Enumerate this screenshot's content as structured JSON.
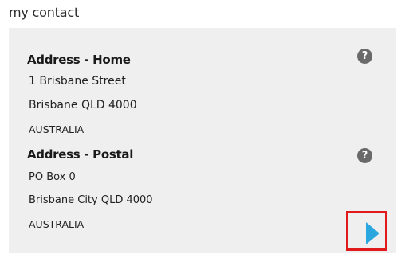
{
  "page": {
    "section_title": "my contact"
  },
  "home_address": {
    "heading": "Address - Home",
    "line1": "1 Brisbane Street",
    "line2": "Brisbane QLD 4000",
    "country": "AUSTRALIA",
    "help_glyph": "?"
  },
  "postal_address": {
    "heading": "Address - Postal",
    "line1": "PO Box 0",
    "line2": "Brisbane City QLD 4000",
    "country": "AUSTRALIA",
    "help_glyph": "?"
  },
  "navigation": {
    "next_icon": "play-triangle-right",
    "next_color": "#2aa7df",
    "highlight_color": "#e01a1a"
  }
}
